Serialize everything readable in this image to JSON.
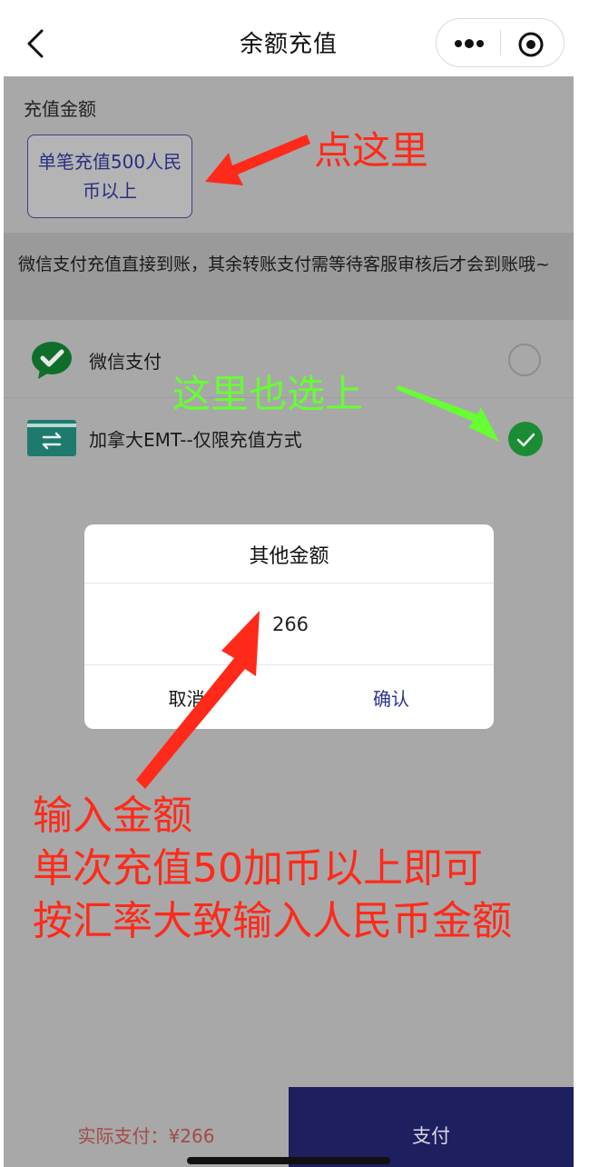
{
  "header": {
    "title": "余额充值"
  },
  "amount": {
    "label": "充值金额",
    "option_label": "单笔充值500人民币以上"
  },
  "notice": "微信支付充值直接到账，其余转账支付需等待客服审核后才会到账哦~",
  "payment_methods": [
    {
      "label": "微信支付",
      "selected": false,
      "icon": "wechat-pay-icon"
    },
    {
      "label": "加拿大EMT--仅限充值方式",
      "selected": true,
      "icon": "transfer-card-icon"
    }
  ],
  "dialog": {
    "title": "其他金额",
    "input_value": "266",
    "cancel_label": "取消",
    "confirm_label": "确认"
  },
  "bottom_bar": {
    "actual_pay": "实际支付：¥266",
    "pay_label": "支付"
  },
  "annotations": {
    "click_here": "点这里",
    "select_too": "这里也选上",
    "instructions": [
      "输入金额",
      "单次充值50加币以上即可",
      "按汇率大致输入人民币金额"
    ]
  },
  "colors": {
    "primary": "#1e1f5e",
    "wechat_green": "#1a8c33",
    "annotation_red": "#ff2a1a",
    "annotation_green": "#66ff33",
    "mask_gray": "#a8a8a8"
  }
}
